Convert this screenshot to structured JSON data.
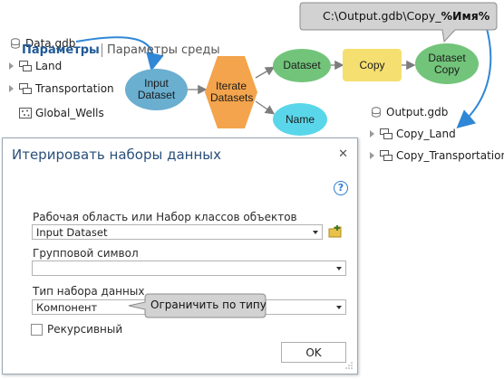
{
  "left_tree": {
    "root": "Data.gdb",
    "items": [
      "Land",
      "Transportation",
      "Global_Wells"
    ]
  },
  "right_tree": {
    "root": "Output.gdb",
    "items": [
      "Copy_Land",
      "Copy_Transportation"
    ]
  },
  "model": {
    "input_dataset": "Input Dataset",
    "iterate": "Iterate Datasets",
    "dataset": "Dataset",
    "name": "Name",
    "copy": "Copy",
    "dataset_copy": "Dataset Copy"
  },
  "path_callout": {
    "prefix": "C:\\Output.gdb\\Copy_",
    "variable": "%Имя%"
  },
  "dialog": {
    "title": "Итерировать наборы данных",
    "tab_parameters": "Параметры",
    "tab_environments": "Параметры среды",
    "workspace_label": "Рабочая область или Набор классов объектов",
    "workspace_value": "Input Dataset",
    "wildcard_label": "Групповой символ",
    "wildcard_value": "",
    "dataset_type_label": "Тип набора данных",
    "dataset_type_value": "Компонент",
    "recursive_label": "Рекурсивный",
    "recursive_checked": false,
    "ok": "OK",
    "close": "✕",
    "help": "?"
  },
  "type_callout": "Ограничить по типу",
  "colors": {
    "input": "#6aaed0",
    "iterate": "#f4a44c",
    "dataset": "#72c47a",
    "name": "#5ad6ea",
    "copy": "#f5df70",
    "arrow_blue": "#2f87d6"
  }
}
